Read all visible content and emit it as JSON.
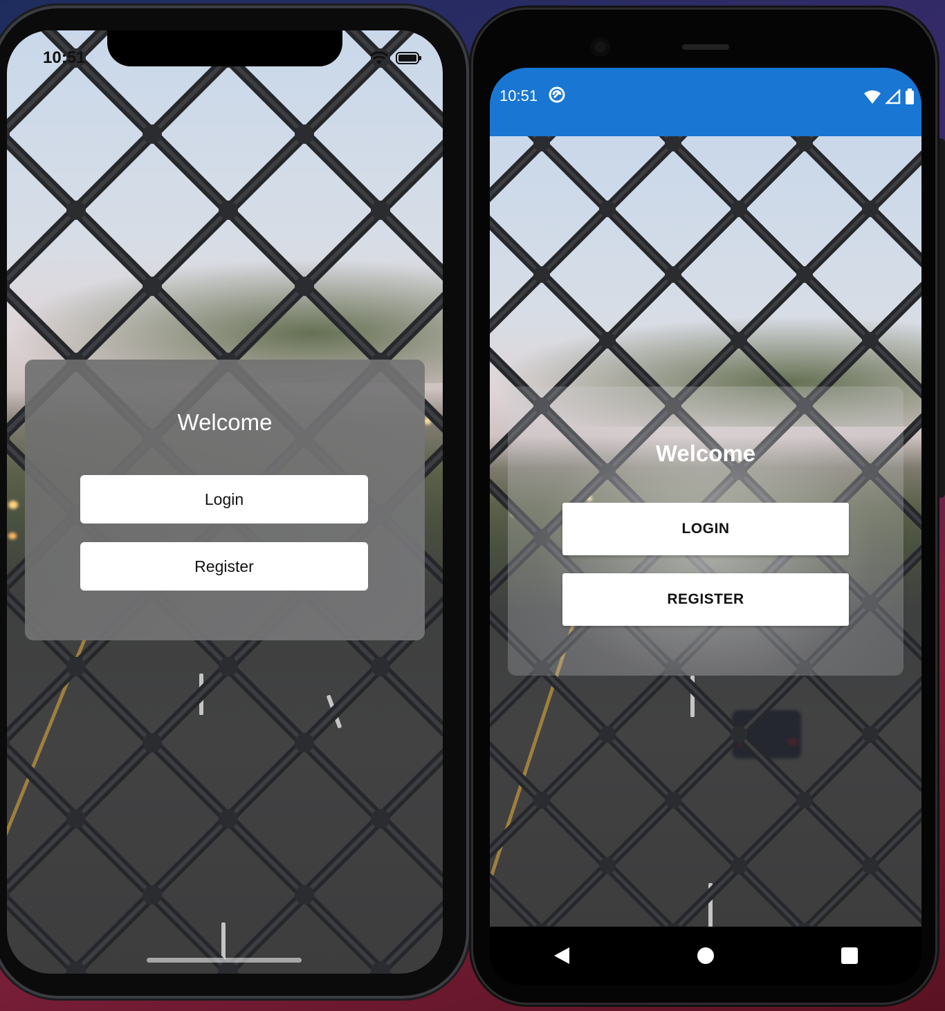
{
  "ios": {
    "status": {
      "time": "10:51"
    },
    "card": {
      "title": "Welcome",
      "login_label": "Login",
      "register_label": "Register"
    }
  },
  "android": {
    "status": {
      "time": "10:51"
    },
    "card": {
      "title": "Welcome",
      "login_label": "LOGIN",
      "register_label": "REGISTER"
    },
    "nav": [
      "back-icon",
      "home-icon",
      "recents-icon"
    ]
  },
  "colors": {
    "android_status_bar": "#1976d2",
    "button_background": "#ffffff"
  }
}
